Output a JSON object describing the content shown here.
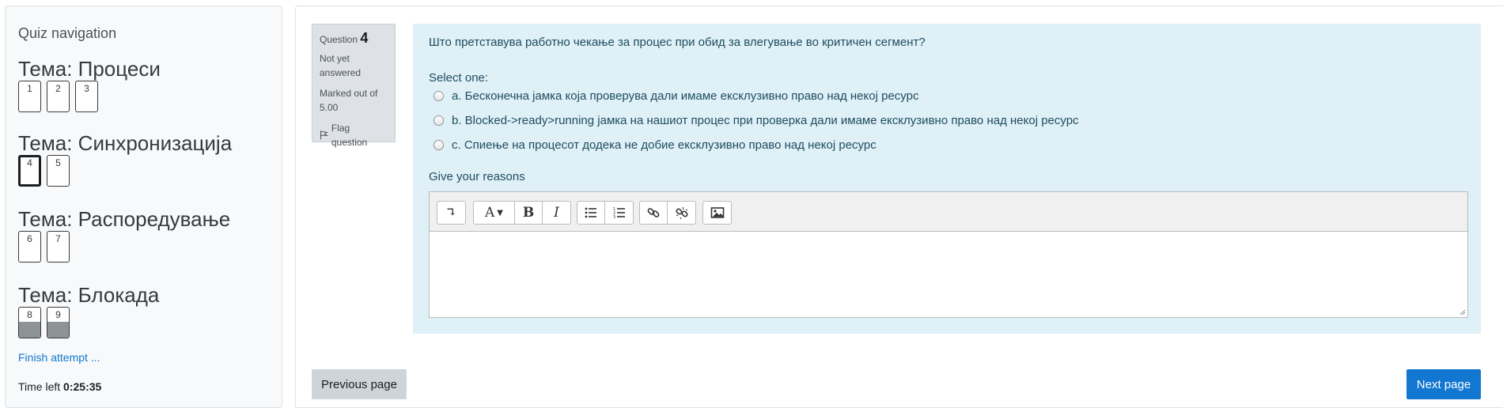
{
  "quiz_navigation": {
    "title": "Quiz navigation",
    "sections": [
      {
        "heading": "Тема: Процеси",
        "questions": [
          "1",
          "2",
          "3"
        ]
      },
      {
        "heading": "Тема: Синхронизација",
        "questions": [
          "4",
          "5"
        ]
      },
      {
        "heading": "Тема: Распоредување",
        "questions": [
          "6",
          "7"
        ]
      },
      {
        "heading": "Тема: Блокада",
        "questions": [
          "8",
          "9"
        ]
      }
    ],
    "current_question": "4",
    "answered_questions": [
      "8",
      "9"
    ],
    "finish_link": "Finish attempt ...",
    "time_left_label": "Time left",
    "time_left_value": "0:25:35"
  },
  "question_info": {
    "label": "Question",
    "number": "4",
    "state_line1": "Not yet",
    "state_line2": "answered",
    "grade_line1": "Marked out of",
    "grade_line2": "5.00",
    "flag_label": "Flag question",
    "flag_icon": "flag-icon"
  },
  "question": {
    "text": "Што претставува работно чекање за процес при обид за влегување во критичен сегмент?",
    "prompt": "Select one:",
    "options": [
      "a. Бесконечна јамка која проверува дали имаме ексклузивно право над некој ресурс",
      "b. Blocked->ready>running јамка на нашиот процес при проверка дали имаме ексклузивно право над некој ресурс",
      "c. Спиење на процесот додека не добие ексклузивно право над некој ресурс"
    ],
    "reasons_label": "Give your reasons"
  },
  "editor": {
    "toolbar": {
      "toggle": "↴",
      "font_style": "A",
      "bold": "B",
      "italic": "I"
    },
    "icons": [
      "show-more-icon",
      "font-style-icon",
      "bold-icon",
      "italic-icon",
      "unordered-list-icon",
      "ordered-list-icon",
      "link-icon",
      "unlink-icon",
      "image-icon"
    ],
    "content": ""
  },
  "buttons": {
    "previous": "Previous page",
    "next": "Next page"
  },
  "colors": {
    "accent": "#1177d1",
    "question_bg": "#dff0f7",
    "info_bg": "#dee2e6",
    "answered_fill": "#8e9396"
  }
}
